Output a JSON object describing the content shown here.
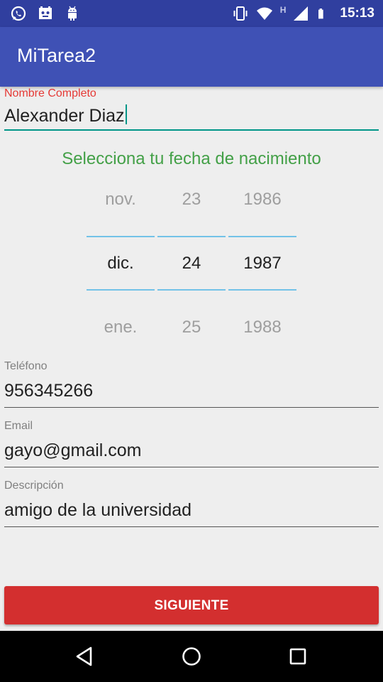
{
  "status_bar": {
    "time": "15:13",
    "network_type": "H",
    "left_icons": [
      "whatsapp-icon",
      "game-controller-icon",
      "android-icon"
    ],
    "right_icons": [
      "vibrate-icon",
      "wifi-icon",
      "signal-icon",
      "battery-icon"
    ]
  },
  "app_bar": {
    "title": "MiTarea2",
    "color": "#3f51b5",
    "status_color": "#303f9f"
  },
  "form": {
    "name": {
      "label": "Nombre Completo",
      "value": "Alexander Diaz"
    },
    "prompt": "Selecciona tu fecha de nacimiento",
    "date_picker": {
      "month": {
        "prev": "nov.",
        "selected": "dic.",
        "next": "ene."
      },
      "day": {
        "prev": "23",
        "selected": "24",
        "next": "25"
      },
      "year": {
        "prev": "1986",
        "selected": "1987",
        "next": "1988"
      }
    },
    "phone": {
      "label": "Teléfono",
      "value": "956345266"
    },
    "email": {
      "label": "Email",
      "value": "gayo@gmail.com"
    },
    "description": {
      "label": "Descripción",
      "value": "amigo de la universidad"
    },
    "next_button": {
      "label": "SIGUIENTE",
      "color": "#d32f2f"
    }
  },
  "nav_bar": {
    "icons": [
      "back-icon",
      "home-icon",
      "recents-icon"
    ]
  }
}
